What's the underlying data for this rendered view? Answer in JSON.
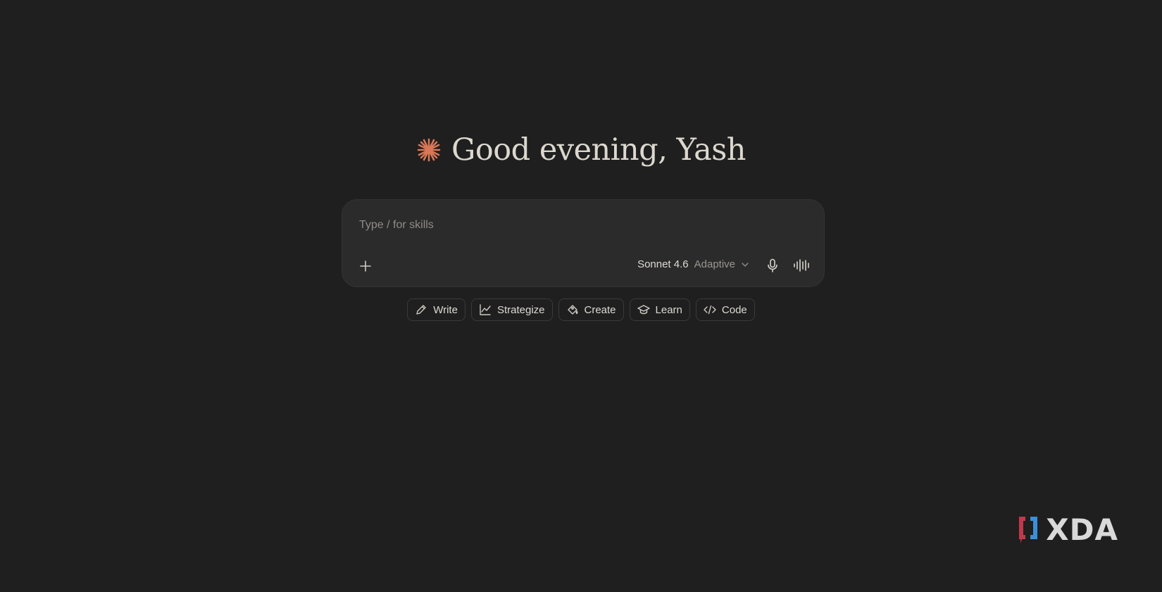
{
  "greeting": {
    "text": "Good evening, Yash",
    "icon": "spark-icon",
    "accent_color": "#d97757"
  },
  "composer": {
    "placeholder": "Type / for skills",
    "value": "",
    "model_name": "Sonnet 4.6",
    "model_mode": "Adaptive",
    "icons": {
      "add": "plus-icon",
      "model_dropdown": "chevron-down-icon",
      "mic": "microphone-icon",
      "voice": "voice-waveform-icon"
    }
  },
  "chips": [
    {
      "label": "Write",
      "icon": "pencil-icon"
    },
    {
      "label": "Strategize",
      "icon": "line-chart-icon"
    },
    {
      "label": "Create",
      "icon": "paint-bucket-icon"
    },
    {
      "label": "Learn",
      "icon": "graduation-cap-icon"
    },
    {
      "label": "Code",
      "icon": "code-brackets-icon"
    }
  ],
  "watermark": {
    "text": "XDA",
    "colors": {
      "left": "#c0394b",
      "right": "#3b8fd9"
    }
  },
  "colors": {
    "background": "#1f1f1f",
    "composer_bg": "#2b2b2b",
    "chip_border": "#3a3a3a",
    "text": "#dedbd4",
    "muted": "#9a968f"
  }
}
